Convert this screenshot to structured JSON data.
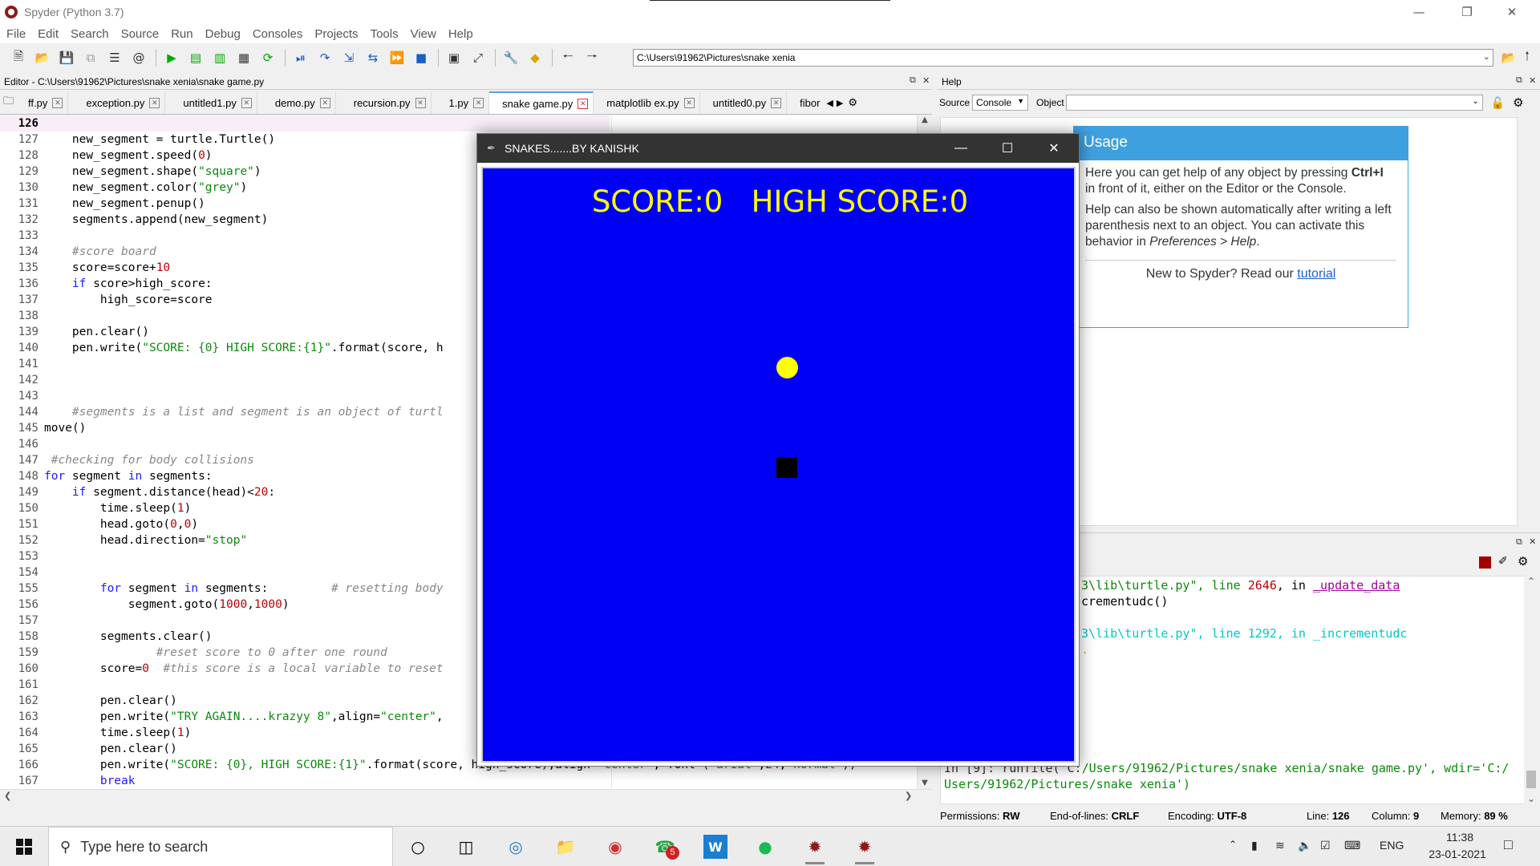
{
  "app": {
    "title": "Spyder (Python 3.7)"
  },
  "menu": [
    "File",
    "Edit",
    "Search",
    "Source",
    "Run",
    "Debug",
    "Consoles",
    "Projects",
    "Tools",
    "View",
    "Help"
  ],
  "toolbar": {
    "path": "C:\\Users\\91962\\Pictures\\snake xenia"
  },
  "editor": {
    "header": "Editor - C:\\Users\\91962\\Pictures\\snake xenia\\snake game.py",
    "tabs": [
      "ff.py",
      "exception.py",
      "untitled1.py",
      "demo.py",
      "recursion.py",
      "1.py",
      "snake game.py",
      "matplotlib ex.py",
      "untitled0.py",
      "fibor"
    ],
    "active_tab": 6,
    "line_numbers": [
      "126",
      "127",
      "128",
      "129",
      "130",
      "131",
      "132",
      "133",
      "134",
      "135",
      "136",
      "137",
      "138",
      "139",
      "140",
      "141",
      "142",
      "143",
      "144",
      "145",
      "146",
      "147",
      "148",
      "149",
      "150",
      "151",
      "152",
      "153",
      "154",
      "155",
      "156",
      "157",
      "158",
      "159",
      "160",
      "161",
      "162",
      "163",
      "164",
      "165",
      "166",
      "167"
    ]
  },
  "help": {
    "header": "Help",
    "source_label": "Source",
    "source_value": "Console",
    "object_label": "Object",
    "usage_title": "Usage",
    "usage_p1_a": "Here you can get help of any object by pressing ",
    "usage_p1_b": "Ctrl+I",
    "usage_p1_c": " in front of it, either on the Editor or the Console.",
    "usage_p2_a": "Help can also be shown automatically after writing a left parenthesis next to an object. You can activate this behavior in ",
    "usage_p2_b": "Preferences > Help",
    "usage_p2_c": ".",
    "usage_footer": "New to Spyder? Read our ",
    "usage_link": "tutorial"
  },
  "console": {
    "line1_a": "3\\lib\\turtle.py\", line ",
    "line1_b": "2646",
    "line1_c": ", in ",
    "line1_d": "_update_data",
    "line2": "crementudc()",
    "line3": "3\\lib\\turtle.py\", line 1292, in _incrementudc",
    "line4": "/Users/91962/Pictures/snake xenia/snake game.py', wdir='C:/",
    "line5": "Users/91962/Pictures/snake xenia')"
  },
  "snake_window": {
    "title": "SNAKES.......BY KANISHK",
    "score_label": "SCORE:0",
    "high_score_label": "HIGH SCORE:0"
  },
  "statusbar": {
    "permissions_label": "Permissions:",
    "permissions_value": "RW",
    "eol_label": "End-of-lines:",
    "eol_value": "CRLF",
    "encoding_label": "Encoding:",
    "encoding_value": "UTF-8",
    "line_label": "Line:",
    "line_value": "126",
    "column_label": "Column:",
    "column_value": "9",
    "memory_label": "Memory:",
    "memory_value": "89 %"
  },
  "taskbar": {
    "search_placeholder": "Type here to search",
    "lang": "ENG",
    "time": "11:38",
    "date": "23-01-2021",
    "whatsapp_badge": "5"
  },
  "colors": {
    "canvas": "#0000f5",
    "score_text": "#ffff00",
    "accent": "#3fa0e0"
  }
}
